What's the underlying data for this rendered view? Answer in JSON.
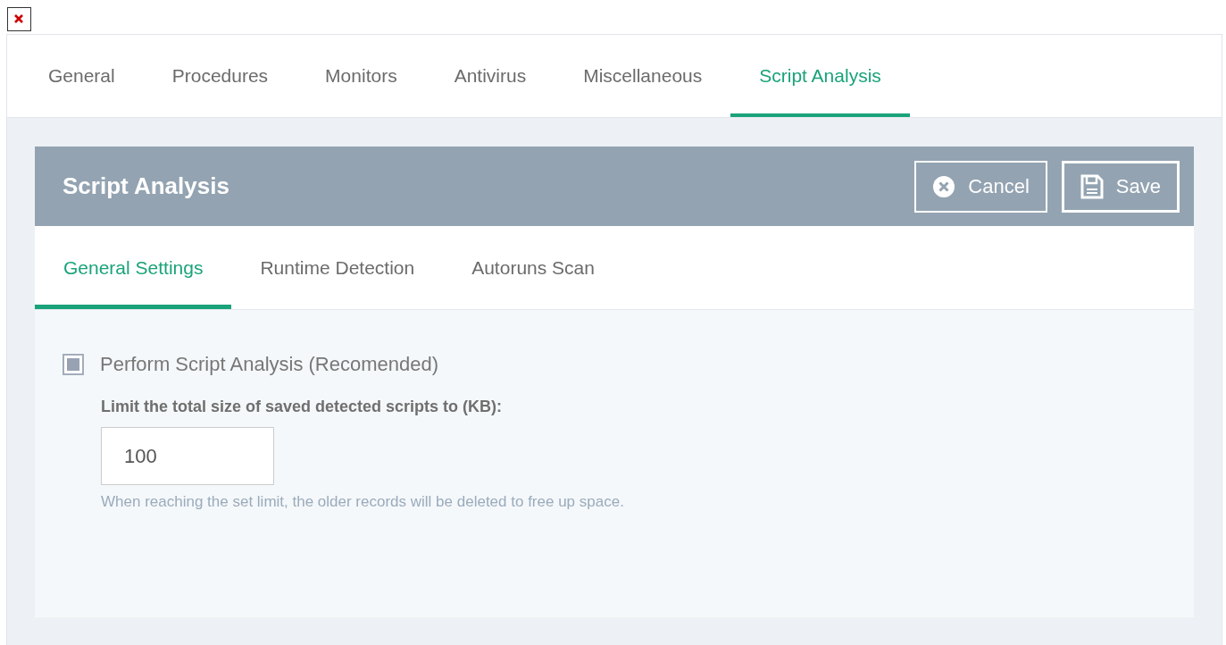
{
  "tabs": [
    {
      "label": "General",
      "selected": false
    },
    {
      "label": "Procedures",
      "selected": false
    },
    {
      "label": "Monitors",
      "selected": false
    },
    {
      "label": "Antivirus",
      "selected": false
    },
    {
      "label": "Miscellaneous",
      "selected": false
    },
    {
      "label": "Script Analysis",
      "selected": true
    }
  ],
  "panel": {
    "title": "Script Analysis",
    "buttons": [
      {
        "kind": "cancel",
        "label": "Cancel"
      },
      {
        "kind": "save",
        "label": "Save"
      }
    ]
  },
  "subtabs": [
    {
      "label": "General Settings",
      "selected": true
    },
    {
      "label": "Runtime Detection",
      "selected": false
    },
    {
      "label": "Autoruns Scan",
      "selected": false
    }
  ],
  "settings": {
    "checkbox": {
      "label": "Perform Script Analysis (Recomended)",
      "checked": true
    },
    "limit_label": "Limit the total size of saved detected scripts to (KB):",
    "limit_value": "100",
    "help": "When reaching the set limit, the older records will be deleted to free up space."
  }
}
